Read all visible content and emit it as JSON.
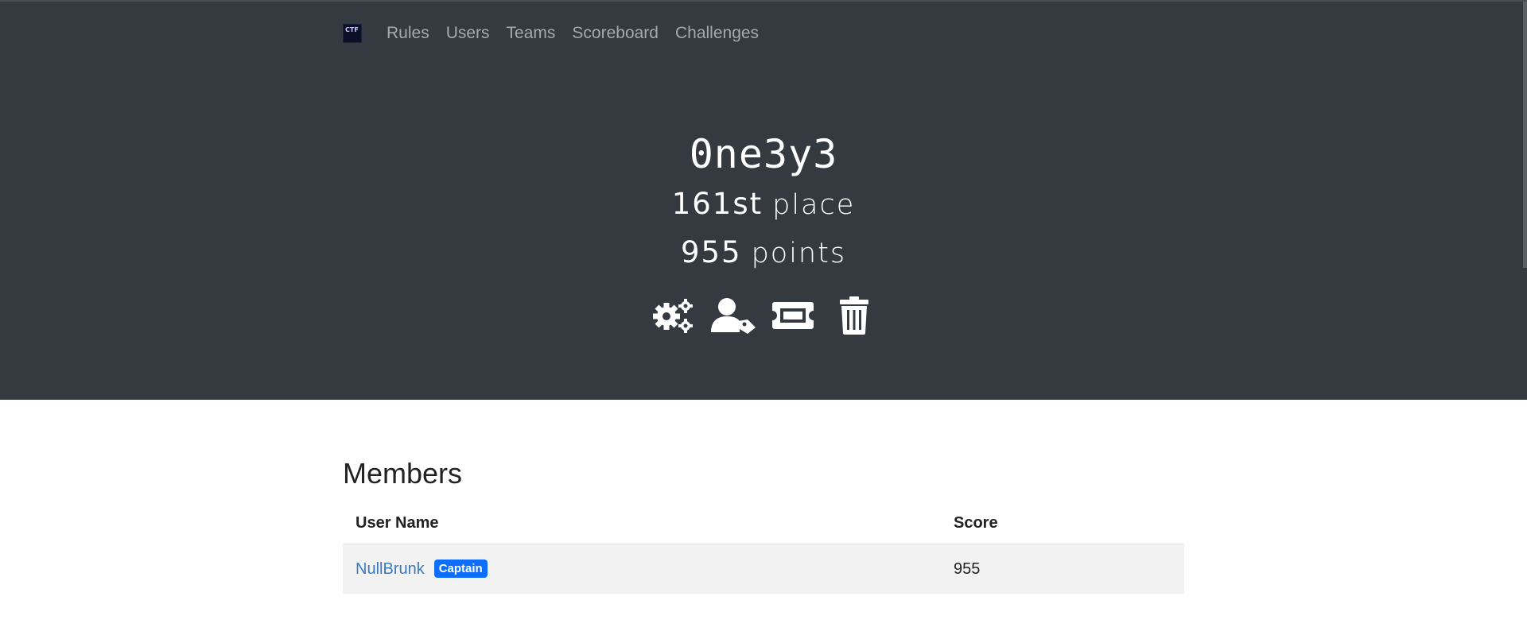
{
  "nav": {
    "logo_text": "CTF",
    "items": [
      {
        "label": "Rules"
      },
      {
        "label": "Users"
      },
      {
        "label": "Teams"
      },
      {
        "label": "Scoreboard"
      },
      {
        "label": "Challenges"
      }
    ]
  },
  "team": {
    "name": "0ne3y3",
    "place_value": "161st",
    "place_word": "place",
    "points_value": "955",
    "points_word": "points"
  },
  "actions": [
    {
      "icon": "settings-cogs-icon"
    },
    {
      "icon": "user-tag-icon"
    },
    {
      "icon": "ticket-icon"
    },
    {
      "icon": "trash-icon"
    }
  ],
  "members": {
    "title": "Members",
    "columns": [
      "User Name",
      "Score"
    ],
    "rows": [
      {
        "user": "NullBrunk",
        "badge": "Captain",
        "score": "955"
      }
    ]
  },
  "colors": {
    "header_bg": "#353a40",
    "link": "#3a7bbf",
    "badge": "#0d6efd"
  }
}
